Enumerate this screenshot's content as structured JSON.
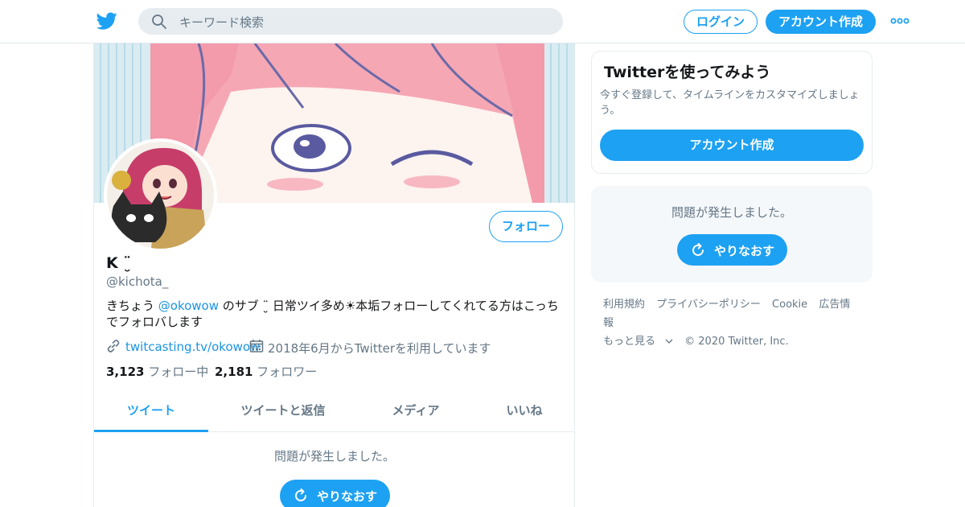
{
  "header": {
    "search_placeholder": "キーワード検索",
    "login_label": "ログイン",
    "signup_label": "アカウント作成",
    "more_icon": "more-dots-icon",
    "logo_icon": "twitter-bird-icon"
  },
  "profile": {
    "name": "K ¨̮",
    "handle": "@kichota_",
    "follow_label": "フォロー",
    "bio_prefix": "きちょう ",
    "bio_mention": "@okowow",
    "bio_suffix": " のサブ ¨̮ 日常ツイ多め☀︎本垢フォローしてくれてる方はこっちでフォロバします",
    "website": "twitcasting.tv/okowow",
    "joined": "2018年6月からTwitterを利用しています",
    "following_count": "3,123",
    "following_label": "フォロー中",
    "followers_count": "2,181",
    "followers_label": "フォロワー"
  },
  "tabs": [
    {
      "label": "ツイート",
      "active": true
    },
    {
      "label": "ツイートと返信",
      "active": false
    },
    {
      "label": "メディア",
      "active": false
    },
    {
      "label": "いいね",
      "active": false
    }
  ],
  "timeline": {
    "error_text": "問題が発生しました。",
    "retry_label": "やりなおす"
  },
  "sidebar": {
    "card_title": "Twitterを使ってみよう",
    "card_desc": "今すぐ登録して、タイムラインをカスタマイズしましょう。",
    "card_button": "アカウント作成",
    "error_text": "問題が発生しました。",
    "retry_label": "やりなおす"
  },
  "footer": {
    "links": [
      "利用規約",
      "プライバシーポリシー",
      "Cookie",
      "広告情報",
      "もっと見る",
      "© 2020 Twitter, Inc."
    ]
  },
  "colors": {
    "accent": "#1da1f2",
    "link": "#1b95e0",
    "muted": "#657786"
  }
}
